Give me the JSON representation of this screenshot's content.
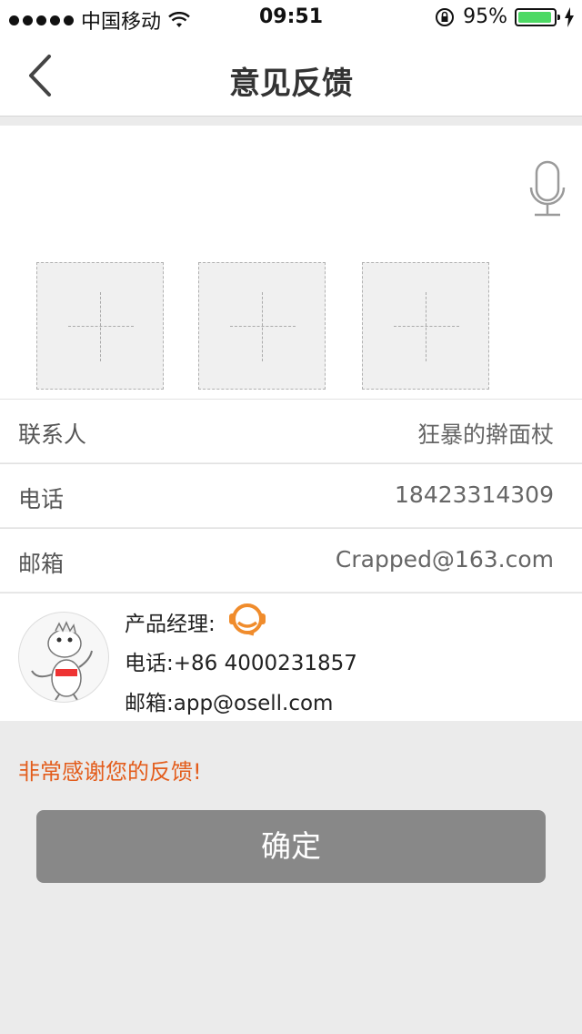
{
  "status_bar": {
    "carrier": "中国移动",
    "time": "09:51",
    "battery_percent": "95%",
    "battery_level": 0.95
  },
  "nav": {
    "title": "意见反馈",
    "back_icon": "chevron-left-icon"
  },
  "feedback": {
    "mic_icon": "microphone-icon",
    "image_slots": [
      {
        "icon": "plus-icon"
      },
      {
        "icon": "plus-icon"
      },
      {
        "icon": "plus-icon"
      }
    ]
  },
  "contact_rows": [
    {
      "label": "联系人",
      "value": "狂暴的擀面杖"
    },
    {
      "label": "电话",
      "value": "18423314309"
    },
    {
      "label": "邮箱",
      "value": "Crapped@163.com"
    }
  ],
  "manager": {
    "title": "产品经理:",
    "phone": "电话:+86 4000231857",
    "email": "邮箱:app@osell.com",
    "support_icon": "customer-service-icon"
  },
  "thanks_message": "非常感谢您的反馈!",
  "confirm_label": "确定",
  "colors": {
    "accent": "#e35d1c",
    "button_bg": "#888888",
    "battery": "#4cd964",
    "page_bg": "#ebebeb"
  }
}
